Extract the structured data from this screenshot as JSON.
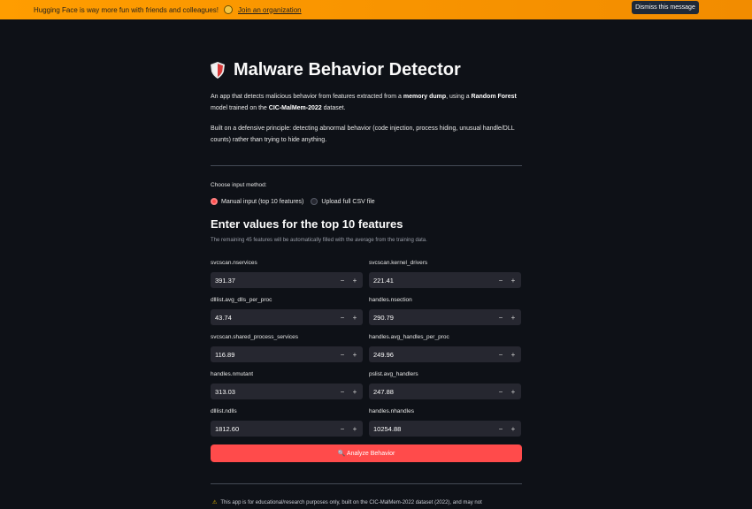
{
  "banner": {
    "message": "Hugging Face is way more fun with friends and colleagues!",
    "link": "Join an organization",
    "dismiss": "Dismiss this message"
  },
  "app": {
    "title": "Malware Behavior Detector",
    "intro_1": "An app that detects malicious behavior from features extracted from a ",
    "intro_bold_1": "memory dump",
    "intro_2": ", using a ",
    "intro_bold_2": "Random Forest",
    "intro_3": " model trained on the ",
    "intro_bold_3": "CIC-MalMem-2022",
    "intro_4": " dataset.",
    "principle": "Built on a defensive principle: detecting abnormal behavior (code injection, process hiding, unusual handle/DLL counts) rather than trying to hide anything."
  },
  "input_method": {
    "label": "Choose input method:",
    "options": [
      "Manual input (top 10 features)",
      "Upload full CSV file"
    ],
    "selected": 0
  },
  "features_section": {
    "heading": "Enter values for the top 10 features",
    "caption": "The remaining 45 features will be automatically filled with the average from the training data.",
    "fields": [
      {
        "label": "svcscan.nservices",
        "value": "391.37"
      },
      {
        "label": "svcscan.kernel_drivers",
        "value": "221.41"
      },
      {
        "label": "dlllist.avg_dlls_per_proc",
        "value": "43.74"
      },
      {
        "label": "handles.nsection",
        "value": "290.79"
      },
      {
        "label": "svcscan.shared_process_services",
        "value": "116.89"
      },
      {
        "label": "handles.avg_handles_per_proc",
        "value": "249.96"
      },
      {
        "label": "handles.nmutant",
        "value": "313.03"
      },
      {
        "label": "pslist.avg_handlers",
        "value": "247.88"
      },
      {
        "label": "dlllist.ndlls",
        "value": "1812.60"
      },
      {
        "label": "handles.nhandles",
        "value": "10254.88"
      }
    ],
    "minus": "−",
    "plus": "+"
  },
  "analyze_button": "🔍 Analyze Behavior",
  "footer": {
    "warning_icon": "⚠",
    "text": "This app is for educational/research purposes only, built on the CIC-MalMem-2022 dataset (2022), and may not"
  },
  "colors": {
    "background": "#0e1117",
    "banner": "#ff9d00",
    "accent": "#ff4b4b",
    "input_bg": "#262730"
  }
}
